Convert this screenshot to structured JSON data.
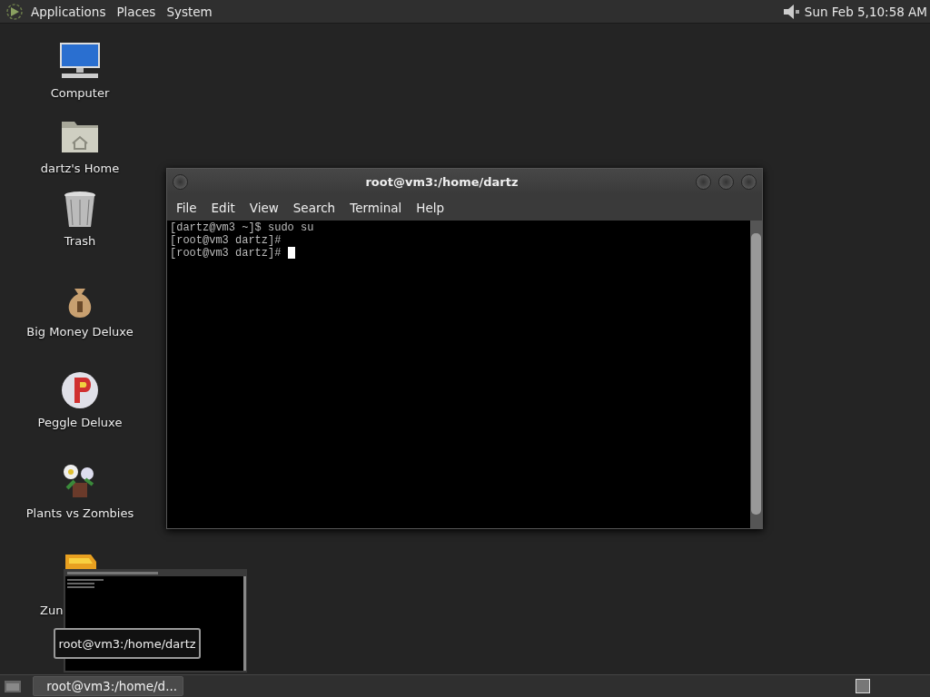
{
  "top_panel": {
    "menus": [
      "Applications",
      "Places",
      "System"
    ],
    "clock": "Sun Feb  5,10:58 AM"
  },
  "desktop_icons": [
    {
      "kind": "computer",
      "label": "Computer"
    },
    {
      "kind": "home",
      "label": "dartz's Home"
    },
    {
      "kind": "trash",
      "label": "Trash"
    },
    {
      "kind": "money",
      "label": "Big Money Deluxe"
    },
    {
      "kind": "peggle",
      "label": "Peggle Deluxe"
    },
    {
      "kind": "plants",
      "label": "Plants vs Zombies"
    },
    {
      "kind": "zuma",
      "label": "Zun"
    }
  ],
  "terminal_window": {
    "title": "root@vm3:/home/dartz",
    "menus": [
      "File",
      "Edit",
      "View",
      "Search",
      "Terminal",
      "Help"
    ],
    "lines": [
      "[dartz@vm3 ~]$ sudo su",
      "[root@vm3 dartz]#",
      "[root@vm3 dartz]# "
    ],
    "cursor": true
  },
  "window_preview": {
    "tooltip": "root@vm3:/home/dartz"
  },
  "taskbar": {
    "tasks": [
      {
        "label": "root@vm3:/home/d...",
        "selected": true
      }
    ]
  }
}
